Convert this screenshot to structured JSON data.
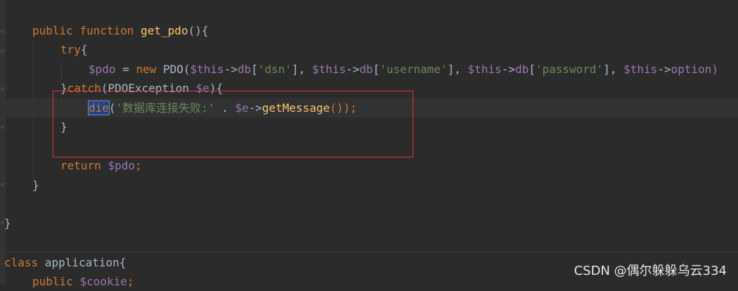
{
  "code": {
    "l1": {
      "kw1": "public",
      "kw2": "function",
      "fn": "get_pdo",
      "p": "(){"
    },
    "l2": {
      "kw": "try",
      "p": "{"
    },
    "l3": {
      "v1": "$pdo",
      "eq": " = ",
      "kw": "new",
      "cls": " PDO(",
      "v2": "$this",
      "a1": "->",
      "db1": "db",
      "b1": "[",
      "s1": "'dsn'",
      "c1": "], ",
      "v3": "$this",
      "a2": "->",
      "db2": "db",
      "b2": "[",
      "s2": "'username'",
      "c2": "], ",
      "v4": "$this",
      "a3": "->",
      "db3": "db",
      "b3": "[",
      "s3": "'password'",
      "c3": "], ",
      "v5": "$this",
      "a4": "->",
      "opt": "option)"
    },
    "l4": {
      "p1": "}",
      "kw": "catch",
      "p2": "(PDOException ",
      "v": "$e",
      "p3": "){"
    },
    "l5": {
      "sel": "die",
      "p1": "(",
      "s": "'数据库连接失败:'",
      "p2": " . ",
      "v": "$e",
      "a": "->",
      "fn": "getMessage",
      "p3": "());"
    },
    "l6": {
      "p": "}"
    },
    "l8": {
      "kw": "return",
      "sp": " ",
      "v": "$pdo",
      "p": ";"
    },
    "l9": {
      "p": "}"
    },
    "l11": {
      "p": "}"
    },
    "l13": {
      "kw": "class",
      "p": " application{"
    },
    "l14": {
      "kw": "public",
      "sp": " ",
      "v": "$cookie",
      "p": ";"
    }
  },
  "watermark": "CSDN @偶尔躲躲乌云334",
  "colors": {
    "background": "#2b2b2b",
    "keyword": "#cc7832",
    "function": "#ffc66d",
    "variable": "#9876aa",
    "string": "#6a8759",
    "highlight_box": "#d43a3a"
  }
}
